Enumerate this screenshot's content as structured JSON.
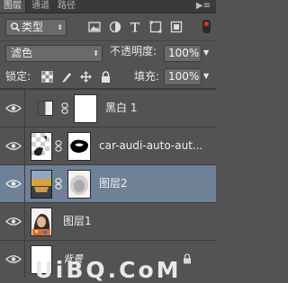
{
  "panel": {
    "tabs": [
      {
        "label": "图层",
        "active": true
      },
      {
        "label": "通道",
        "active": false
      },
      {
        "label": "路径",
        "active": false
      }
    ],
    "menu_glyph": "▶≡"
  },
  "filter": {
    "kind_label": "类型",
    "kind_icon": "search-icon",
    "filter_icons": [
      "image-filter-icon",
      "adjustment-filter-icon",
      "text-filter-icon",
      "shape-filter-icon",
      "smart-object-filter-icon"
    ]
  },
  "blend": {
    "mode": "滤色",
    "opacity_label": "不透明度:",
    "opacity_value": "100%"
  },
  "lock": {
    "label": "锁定:",
    "icons": [
      "lock-transparency-icon",
      "lock-pixels-icon",
      "lock-position-icon",
      "lock-all-icon"
    ],
    "fill_label": "填充:",
    "fill_value": "100%"
  },
  "layers": [
    {
      "name": "黑白 1",
      "type": "adjustment",
      "visible": true,
      "selected": false
    },
    {
      "name": "car-audi-auto-aut...",
      "type": "masked",
      "visible": true,
      "selected": false
    },
    {
      "name": "图层2",
      "type": "masked",
      "visible": true,
      "selected": true
    },
    {
      "name": "图层1",
      "type": "pixel",
      "visible": true,
      "selected": false
    },
    {
      "name": "背景",
      "type": "background",
      "visible": true,
      "selected": false,
      "locked": true
    }
  ],
  "watermark": "UiBQ.CoM",
  "colors": {
    "panel_bg": "#535353",
    "selected_row": "#6f8196",
    "toggle_dot": "#e63030"
  }
}
